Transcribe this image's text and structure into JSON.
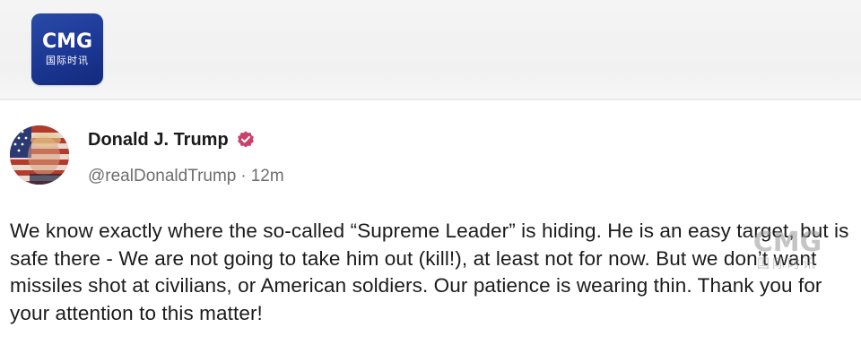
{
  "broadcaster": {
    "logo_text": "CMG",
    "logo_subtext": "国际时讯",
    "brand_color": "#1f3c99"
  },
  "post": {
    "author": {
      "display_name": "Donald J. Trump",
      "handle": "@realDonaldTrump",
      "separator": "·",
      "time_ago": "12m",
      "verified_badge_color": "#c9426b",
      "avatar_icon": "flag-portrait-avatar"
    },
    "body": "We know exactly where the so-called “Supreme Leader” is hiding. He is an easy target, but is safe there - We are not going to take him out (kill!), at least not for now. But we don’t want missiles shot at civilians, or American soldiers. Our patience is wearing thin. Thank you for your attention to this matter!"
  },
  "watermark": {
    "text": "CMG",
    "subtext": "国际时讯"
  }
}
